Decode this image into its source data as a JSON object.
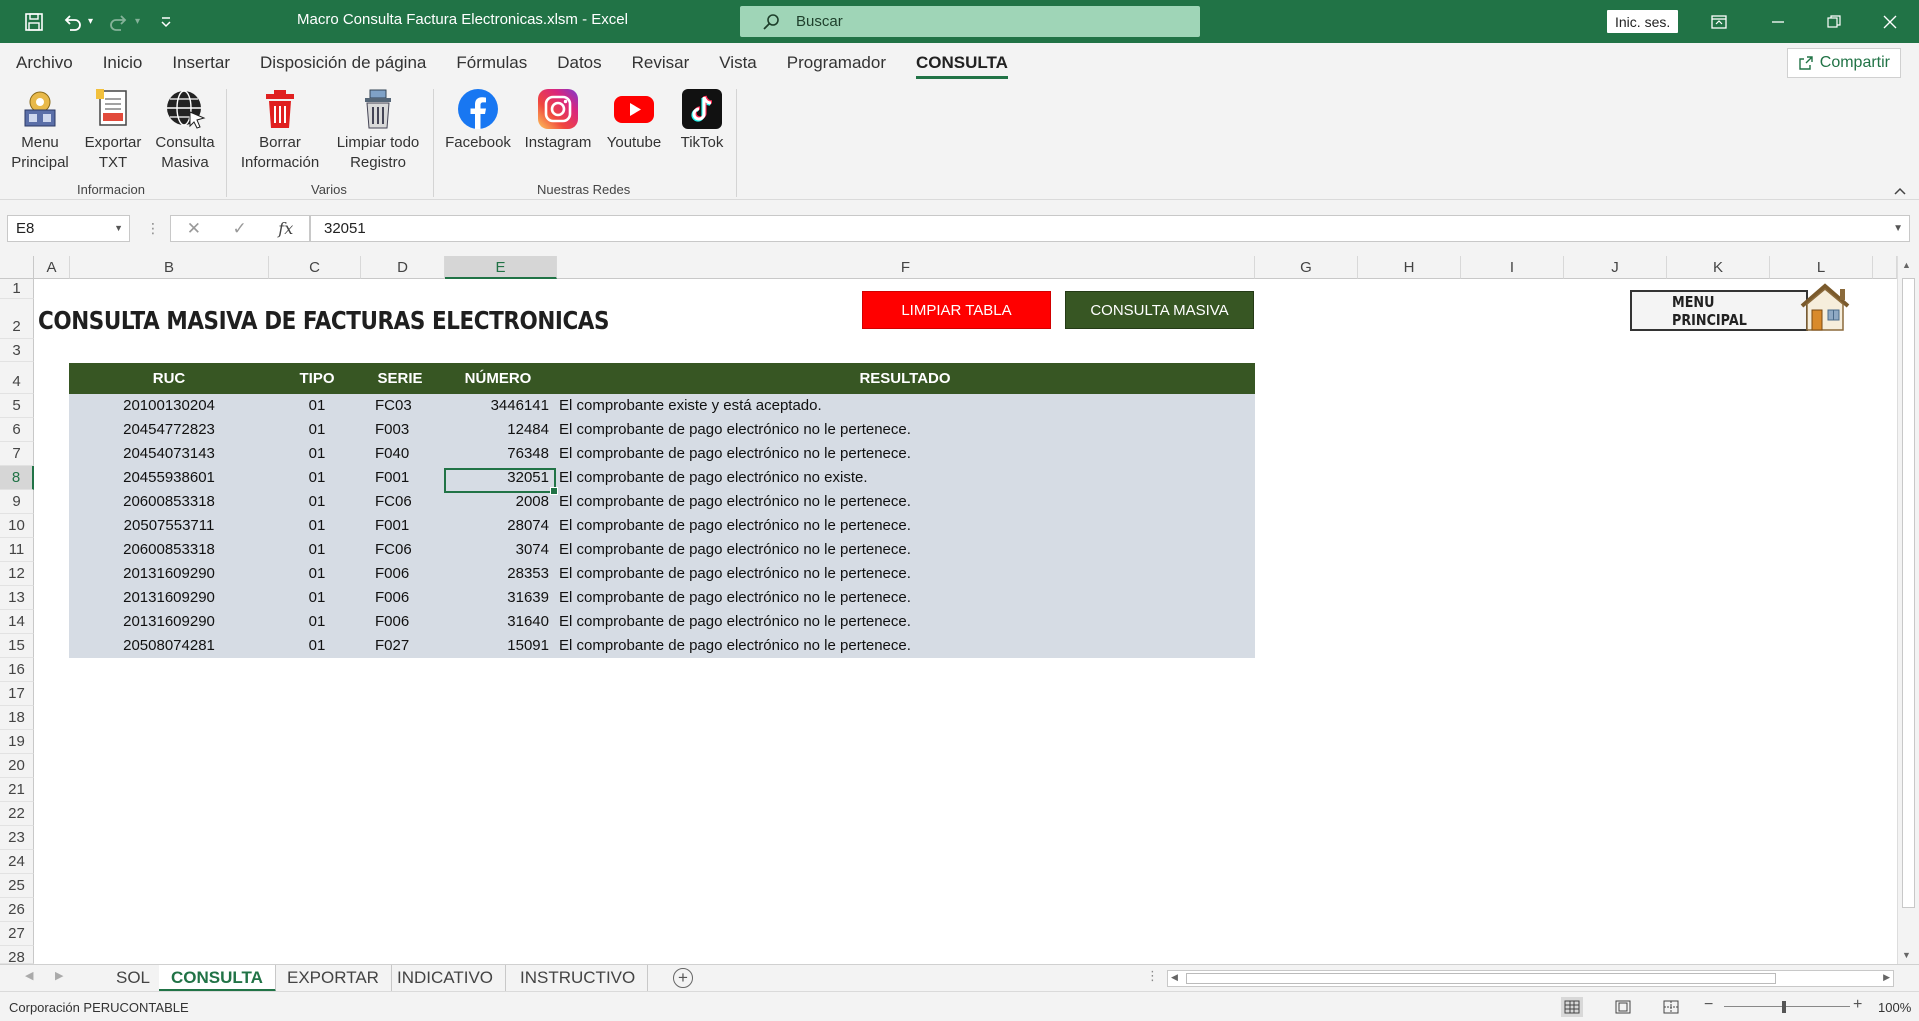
{
  "window": {
    "doc_title": "Macro Consulta Factura Electronicas.xlsm  -  Excel",
    "search_placeholder": "Buscar",
    "signin_label": "Inic. ses."
  },
  "menu": {
    "tabs": [
      "Archivo",
      "Inicio",
      "Insertar",
      "Disposición de página",
      "Fórmulas",
      "Datos",
      "Revisar",
      "Vista",
      "Programador",
      "CONSULTA"
    ],
    "active": "CONSULTA",
    "share_label": "Compartir"
  },
  "ribbon": {
    "buttons": [
      {
        "line1": "Menu",
        "line2": "Principal"
      },
      {
        "line1": "Exportar",
        "line2": "TXT"
      },
      {
        "line1": "Consulta",
        "line2": "Masiva"
      },
      {
        "line1": "Borrar",
        "line2": "Información"
      },
      {
        "line1": "Limpiar todo",
        "line2": "Registro"
      },
      {
        "line1": "Facebook",
        "line2": ""
      },
      {
        "line1": "Instagram",
        "line2": ""
      },
      {
        "line1": "Youtube",
        "line2": ""
      },
      {
        "line1": "TikTok",
        "line2": ""
      }
    ],
    "groups": [
      "Informacion",
      "Varios",
      "Nuestras Redes"
    ]
  },
  "formula_bar": {
    "name_box": "E8",
    "fx_label": "fx",
    "value": "32051"
  },
  "columns": [
    "A",
    "B",
    "C",
    "D",
    "E",
    "F",
    "G",
    "H",
    "I",
    "J",
    "K",
    "L"
  ],
  "selected_column": "E",
  "rows": [
    "1",
    "2",
    "3",
    "4",
    "5",
    "6",
    "7",
    "8",
    "9",
    "10",
    "11",
    "12",
    "13",
    "14",
    "15",
    "16",
    "17",
    "18",
    "19",
    "20",
    "21",
    "22",
    "23",
    "24",
    "25",
    "26",
    "27",
    "28"
  ],
  "selected_row": "8",
  "sheet": {
    "title": "CONSULTA MASIVA DE FACTURAS ELECTRONICAS",
    "btn_limpiar": "LIMPIAR TABLA",
    "btn_consulta": "CONSULTA MASIVA",
    "btn_menu": "MENU PRINCIPAL",
    "table_headers": [
      "RUC",
      "TIPO",
      "SERIE",
      "NÚMERO",
      "RESULTADO"
    ],
    "table_rows": [
      [
        "20100130204",
        "01",
        "FC03",
        "3446141",
        "El comprobante existe y está aceptado."
      ],
      [
        "20454772823",
        "01",
        "F003",
        "12484",
        "El comprobante de pago electrónico no le pertenece."
      ],
      [
        "20454073143",
        "01",
        "F040",
        "76348",
        "El comprobante de pago electrónico no le pertenece."
      ],
      [
        "20455938601",
        "01",
        "F001",
        "32051",
        "El comprobante de pago electrónico no existe."
      ],
      [
        "20600853318",
        "01",
        "FC06",
        "2008",
        "El comprobante de pago electrónico no le pertenece."
      ],
      [
        "20507553711",
        "01",
        "F001",
        "28074",
        "El comprobante de pago electrónico no le pertenece."
      ],
      [
        "20600853318",
        "01",
        "FC06",
        "3074",
        "El comprobante de pago electrónico no le pertenece."
      ],
      [
        "20131609290",
        "01",
        "F006",
        "28353",
        "El comprobante de pago electrónico no le pertenece."
      ],
      [
        "20131609290",
        "01",
        "F006",
        "31639",
        "El comprobante de pago electrónico no le pertenece."
      ],
      [
        "20131609290",
        "01",
        "F006",
        "31640",
        "El comprobante de pago electrónico no le pertenece."
      ],
      [
        "20508074281",
        "01",
        "F027",
        "15091",
        "El comprobante de pago electrónico no le pertenece."
      ]
    ]
  },
  "sheet_tabs": [
    "SOL",
    "CONSULTA",
    "EXPORTAR",
    "INDICATIVO",
    "INSTRUCTIVO"
  ],
  "active_sheet": "CONSULTA",
  "status": {
    "left_text": "Corporación PERUCONTABLE",
    "zoom": "100%"
  },
  "colors": {
    "excel_green": "#217346",
    "table_header": "#375623",
    "table_body": "#d6dce4",
    "btn_red": "#ff0000"
  }
}
